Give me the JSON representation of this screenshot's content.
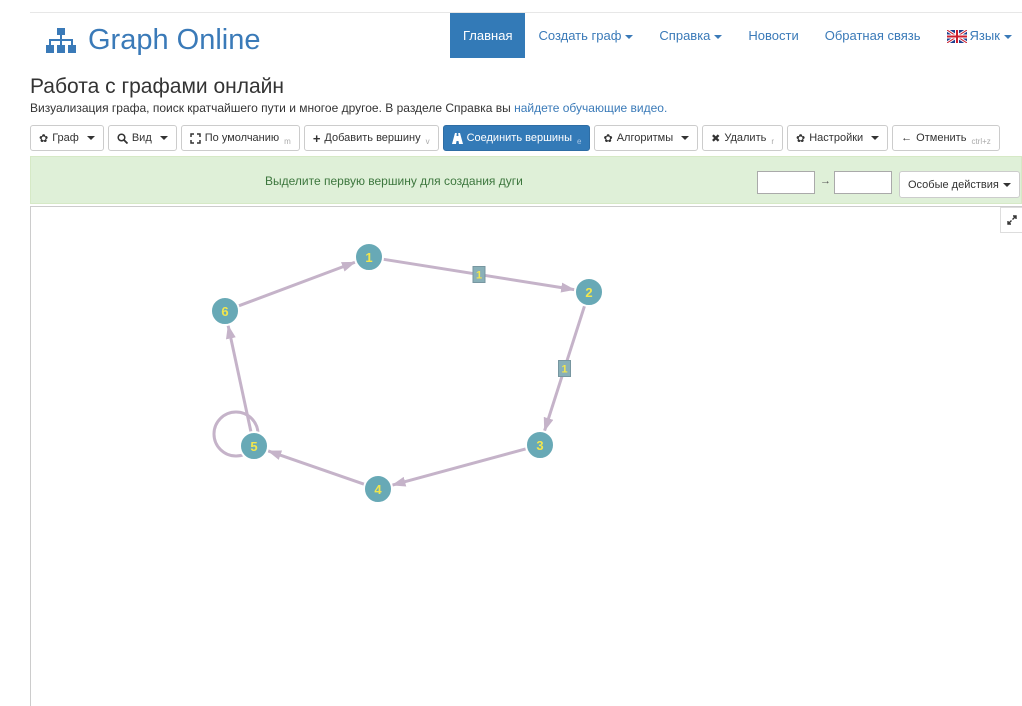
{
  "brand": {
    "title": "Graph Online"
  },
  "nav": {
    "home": "Главная",
    "create": "Создать граф",
    "help": "Справка",
    "news": "Новости",
    "feedback": "Обратная связь",
    "language": "Язык"
  },
  "page": {
    "title": "Работа с графами онлайн",
    "subtitle": "Визуализация графа, поиск кратчайшего пути и многое другое. В разделе Справка вы ",
    "subtitle_link": "найдете обучающие видео."
  },
  "toolbar": {
    "graph": "Граф",
    "view": "Вид",
    "default": "По умолчанию",
    "default_key": "m",
    "add_vertex": "Добавить вершину",
    "add_vertex_key": "v",
    "connect": "Соединить вершины",
    "connect_key": "e",
    "algorithms": "Алгоритмы",
    "delete": "Удалить",
    "delete_key": "r",
    "settings": "Настройки",
    "undo": "Отменить",
    "undo_key": "ctrl+z"
  },
  "alert": {
    "message": "Выделите первую вершину для создания дуги",
    "from_value": "",
    "arrow": "→",
    "to_value": "",
    "special_actions": "Особые действия"
  },
  "graph": {
    "vertices": [
      "1",
      "2",
      "3",
      "4",
      "5",
      "6"
    ],
    "edges": [
      {
        "from": "1",
        "to": "2",
        "weight": "1"
      },
      {
        "from": "2",
        "to": "3",
        "weight": "1"
      },
      {
        "from": "3",
        "to": "4",
        "weight": ""
      },
      {
        "from": "4",
        "to": "5",
        "weight": ""
      },
      {
        "from": "5",
        "to": "6",
        "weight": ""
      },
      {
        "from": "6",
        "to": "1",
        "weight": ""
      },
      {
        "from": "5",
        "to": "5",
        "weight": ""
      }
    ],
    "colors": {
      "vertex_fill": "#68a9b6",
      "vertex_stroke": "#ffffff",
      "vertex_label": "#f2e64d",
      "edge": "#c5b3c9",
      "weight_box": "#89b0b8"
    }
  },
  "colors": {
    "brand": "#3a7ab8",
    "primary": "#337ab7",
    "alert_bg": "#dff0d8",
    "alert_text": "#3c763d"
  },
  "icons": {
    "logo": "sitemap-icon",
    "graph": "gear-icon",
    "view": "zoom-icon",
    "default": "fit-icon",
    "add": "plus-icon",
    "connect": "road-icon",
    "algorithms": "gear-icon",
    "delete": "cross-icon",
    "settings": "gear-icon",
    "undo": "arrow-left-icon",
    "fullscreen": "expand-icon",
    "flag": "uk-flag-icon"
  }
}
